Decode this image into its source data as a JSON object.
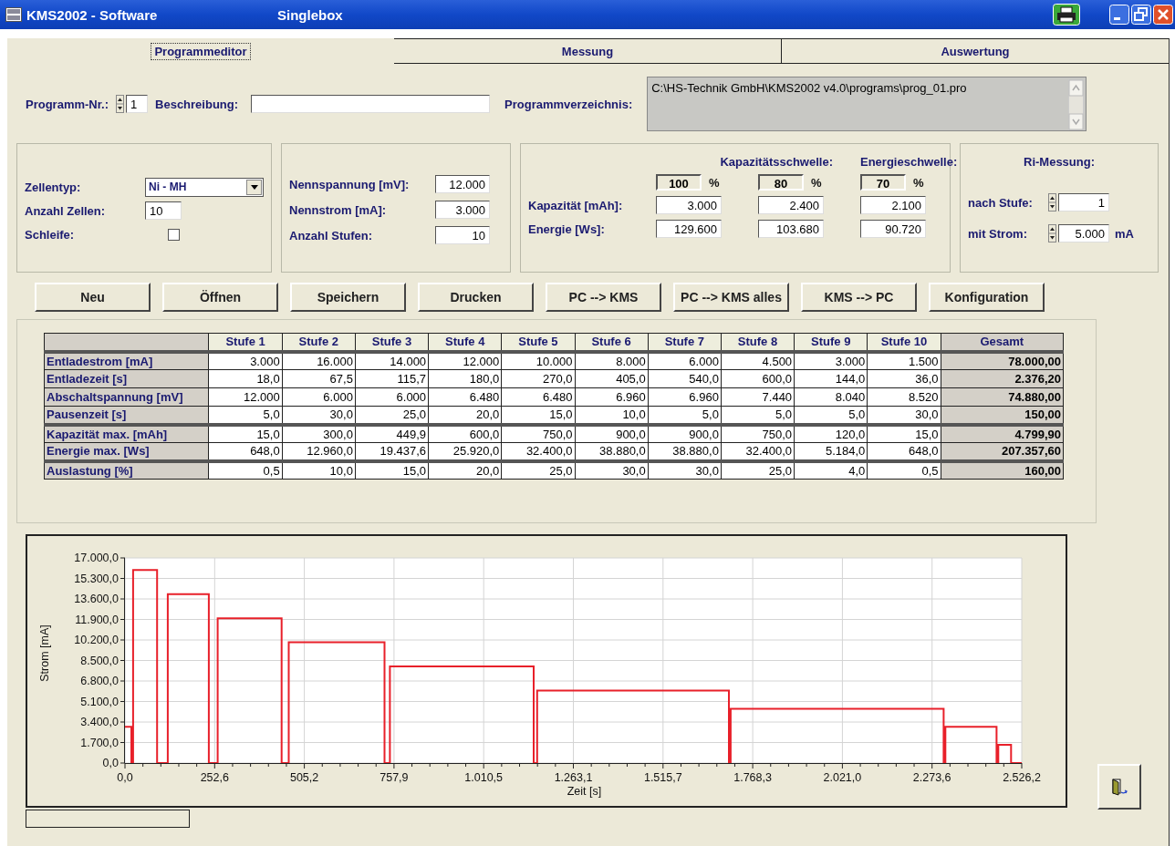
{
  "window": {
    "title": "KMS2002 - Software",
    "subtitle": "Singlebox"
  },
  "tabs": [
    {
      "label": "Programmeditor",
      "selected": true
    },
    {
      "label": "Messung",
      "selected": false
    },
    {
      "label": "Auswertung",
      "selected": false
    }
  ],
  "program": {
    "number": {
      "label": "Programm-Nr.:",
      "value": "1"
    },
    "description": {
      "label": "Beschreibung:"
    },
    "directory": {
      "label": "Programmverzeichnis:",
      "value": "C:\\HS-Technik GmbH\\KMS2002 v4.0\\programs\\prog_01.pro"
    }
  },
  "cell_panel": {
    "fields": [
      {
        "kind": "dropdown",
        "label": "Zellentyp:",
        "value": "Ni - MH"
      },
      {
        "kind": "input",
        "label": "Anzahl Zellen:",
        "value": "10"
      },
      {
        "kind": "checkbox",
        "label": "Schleife:",
        "checked": false
      }
    ]
  },
  "rated_panel": {
    "fields": [
      {
        "label": "Nennspannung [mV]:",
        "value": "12.000"
      },
      {
        "label": "Nennstrom [mA]:",
        "value": "3.000"
      },
      {
        "label": "Anzahl Stufen:",
        "value": "10"
      }
    ]
  },
  "threshold_panel": {
    "headers": [
      "Kapazitätsschwelle:",
      "Energieschwelle:"
    ],
    "percents": [
      {
        "value": "100",
        "unit": "%"
      },
      {
        "value": "80",
        "unit": "%"
      },
      {
        "value": "70",
        "unit": "%"
      }
    ],
    "rows": [
      {
        "label": "Kapazität [mAh]:",
        "values": [
          "3.000",
          "2.400",
          "2.100"
        ]
      },
      {
        "label": "Energie [Ws]:",
        "values": [
          "129.600",
          "103.680",
          "90.720"
        ]
      }
    ]
  },
  "ri_panel": {
    "title": "Ri-Messung:",
    "fields": [
      {
        "label": "nach Stufe:",
        "value": "1"
      },
      {
        "label": "mit Strom:",
        "value": "5.000",
        "unit": "mA"
      }
    ]
  },
  "buttons": [
    "Neu",
    "Öffnen",
    "Speichern",
    "Drucken",
    "PC --> KMS",
    "PC --> KMS alles",
    "KMS --> PC",
    "Konfiguration"
  ],
  "table": {
    "columns": [
      "Stufe 1",
      "Stufe 2",
      "Stufe 3",
      "Stufe 4",
      "Stufe 5",
      "Stufe 6",
      "Stufe 7",
      "Stufe 8",
      "Stufe 9",
      "Stufe 10",
      "Gesamt"
    ],
    "groups": [
      [
        {
          "label": "Entladestrom [mA]",
          "values": [
            "3.000",
            "16.000",
            "14.000",
            "12.000",
            "10.000",
            "8.000",
            "6.000",
            "4.500",
            "3.000",
            "1.500"
          ],
          "total": "78.000,00"
        },
        {
          "label": "Entladezeit [s]",
          "values": [
            "18,0",
            "67,5",
            "115,7",
            "180,0",
            "270,0",
            "405,0",
            "540,0",
            "600,0",
            "144,0",
            "36,0"
          ],
          "total": "2.376,20"
        },
        {
          "label": "Abschaltspannung [mV]",
          "values": [
            "12.000",
            "6.000",
            "6.000",
            "6.480",
            "6.480",
            "6.960",
            "6.960",
            "7.440",
            "8.040",
            "8.520"
          ],
          "total": "74.880,00"
        },
        {
          "label": "Pausenzeit [s]",
          "values": [
            "5,0",
            "30,0",
            "25,0",
            "20,0",
            "15,0",
            "10,0",
            "5,0",
            "5,0",
            "5,0",
            "30,0"
          ],
          "total": "150,00"
        }
      ],
      [
        {
          "label": "Kapazität max. [mAh]",
          "values": [
            "15,0",
            "300,0",
            "449,9",
            "600,0",
            "750,0",
            "900,0",
            "900,0",
            "750,0",
            "120,0",
            "15,0"
          ],
          "total": "4.799,90"
        },
        {
          "label": "Energie max. [Ws]",
          "values": [
            "648,0",
            "12.960,0",
            "19.437,6",
            "25.920,0",
            "32.400,0",
            "38.880,0",
            "38.880,0",
            "32.400,0",
            "5.184,0",
            "648,0"
          ],
          "total": "207.357,60"
        }
      ],
      [
        {
          "label": "Auslastung [%]",
          "values": [
            "0,5",
            "10,0",
            "15,0",
            "20,0",
            "25,0",
            "30,0",
            "30,0",
            "25,0",
            "4,0",
            "0,5"
          ],
          "total": "160,00"
        }
      ]
    ]
  },
  "chart": {
    "chart_data": {
      "type": "line",
      "xlabel": "Zeit [s]",
      "ylabel": "Strom [mA]",
      "x": [
        0,
        18,
        18,
        23,
        23,
        90.5,
        90.5,
        120.5,
        120.5,
        236.2,
        236.2,
        261.2,
        261.2,
        441.2,
        441.2,
        461.2,
        461.2,
        731.2,
        731.2,
        746.2,
        746.2,
        1151.2,
        1151.2,
        1161.2,
        1161.2,
        1701.2,
        1701.2,
        1706.2,
        1706.2,
        2306.2,
        2306.2,
        2311.2,
        2311.2,
        2455.2,
        2455.2,
        2460.2,
        2460.2,
        2496.2,
        2496.2,
        2526.2
      ],
      "grid": true,
      "series": [
        {
          "color": "#e8202a",
          "values": [
            3000,
            3000,
            0,
            0,
            16000,
            16000,
            0,
            0,
            14000,
            14000,
            0,
            0,
            12000,
            12000,
            0,
            0,
            10000,
            10000,
            0,
            0,
            8000,
            8000,
            0,
            0,
            6000,
            6000,
            0,
            0,
            4500,
            4500,
            0,
            0,
            3000,
            3000,
            0,
            0,
            1500,
            1500,
            0,
            0
          ]
        }
      ],
      "xlim": [
        0,
        2526.2
      ],
      "ylim": [
        0,
        17000
      ],
      "xticks": [
        {
          "value": 0,
          "label": "0,0"
        },
        {
          "value": 252.62,
          "label": "252,6"
        },
        {
          "value": 505.24,
          "label": "505,2"
        },
        {
          "value": 757.86,
          "label": "757,9"
        },
        {
          "value": 1010.48,
          "label": "1.010,5"
        },
        {
          "value": 1263.1,
          "label": "1.263,1"
        },
        {
          "value": 1515.72,
          "label": "1.515,7"
        },
        {
          "value": 1768.34,
          "label": "1.768,3"
        },
        {
          "value": 2020.96,
          "label": "2.021,0"
        },
        {
          "value": 2273.58,
          "label": "2.273,6"
        },
        {
          "value": 2526.2,
          "label": "2.526,2"
        }
      ],
      "yticks": [
        {
          "value": 0,
          "label": "0,0"
        },
        {
          "value": 1700,
          "label": "1.700,0"
        },
        {
          "value": 3400,
          "label": "3.400,0"
        },
        {
          "value": 5100,
          "label": "5.100,0"
        },
        {
          "value": 6800,
          "label": "6.800,0"
        },
        {
          "value": 8500,
          "label": "8.500,0"
        },
        {
          "value": 10200,
          "label": "10.200,0"
        },
        {
          "value": 11900,
          "label": "11.900,0"
        },
        {
          "value": 13600,
          "label": "13.600,0"
        },
        {
          "value": 15300,
          "label": "15.300,0"
        },
        {
          "value": 17000,
          "label": "17.000,0"
        }
      ]
    }
  }
}
